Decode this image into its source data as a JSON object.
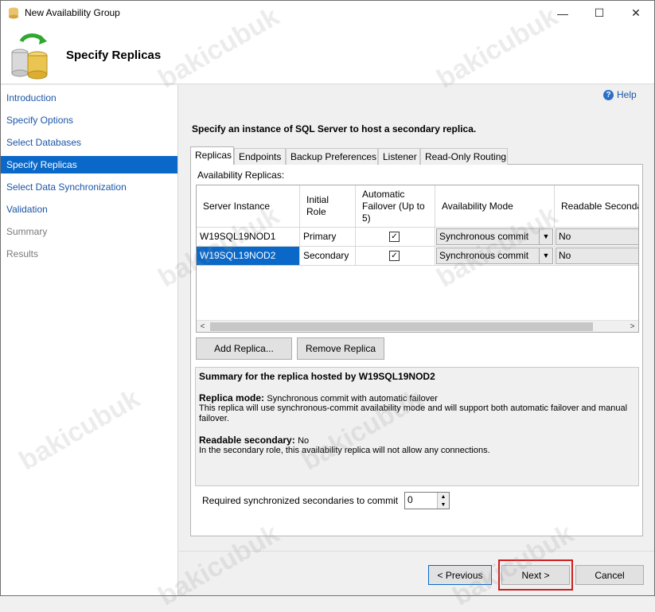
{
  "window": {
    "title": "New Availability Group",
    "controls": {
      "minimize": "—",
      "maximize": "☐",
      "close": "✕"
    }
  },
  "header": {
    "title": "Specify Replicas"
  },
  "nav": {
    "items": [
      {
        "label": "Introduction",
        "state": "link"
      },
      {
        "label": "Specify Options",
        "state": "link"
      },
      {
        "label": "Select Databases",
        "state": "link"
      },
      {
        "label": "Specify Replicas",
        "state": "active"
      },
      {
        "label": "Select Data Synchronization",
        "state": "link"
      },
      {
        "label": "Validation",
        "state": "link"
      },
      {
        "label": "Summary",
        "state": "disabled"
      },
      {
        "label": "Results",
        "state": "disabled"
      }
    ]
  },
  "help": {
    "label": "Help",
    "icon": "?"
  },
  "instruction": "Specify an instance of SQL Server to host a secondary replica.",
  "tabs": [
    "Replicas",
    "Endpoints",
    "Backup Preferences",
    "Listener",
    "Read-Only Routing"
  ],
  "replicas": {
    "section_label": "Availability Replicas:",
    "columns": [
      "Server Instance",
      "Initial Role",
      "Automatic Failover (Up to 5)",
      "Availability Mode",
      "Readable Secondar"
    ],
    "rows": [
      {
        "server": "W19SQL19NOD1",
        "role": "Primary",
        "failover": "✓",
        "mode": "Synchronous commit",
        "readable": "No",
        "selected": false
      },
      {
        "server": "W19SQL19NOD2",
        "role": "Secondary",
        "failover": "✓",
        "mode": "Synchronous commit",
        "readable": "No",
        "selected": true
      }
    ],
    "scroll": {
      "left": "<",
      "right": ">"
    }
  },
  "buttons": {
    "add_replica": "Add Replica...",
    "remove_replica": "Remove Replica",
    "previous": "< Previous",
    "next": "Next >",
    "cancel": "Cancel"
  },
  "summary": {
    "title": "Summary for the replica hosted by W19SQL19NOD2",
    "replica_mode_label": "Replica mode:",
    "replica_mode_value": "Synchronous commit with automatic failover",
    "replica_mode_desc": "This replica will use synchronous-commit availability mode and will support both automatic failover and manual failover.",
    "readable_label": "Readable secondary:",
    "readable_value": "No",
    "readable_desc": "In the secondary role, this availability replica will not allow any connections."
  },
  "required_sync": {
    "label": "Required synchronized secondaries to commit",
    "value": "0"
  },
  "watermark": "bakicubuk",
  "colors": {
    "accent": "#0a68c8",
    "link": "#1a56a6",
    "highlight": "#cc1f1f"
  }
}
